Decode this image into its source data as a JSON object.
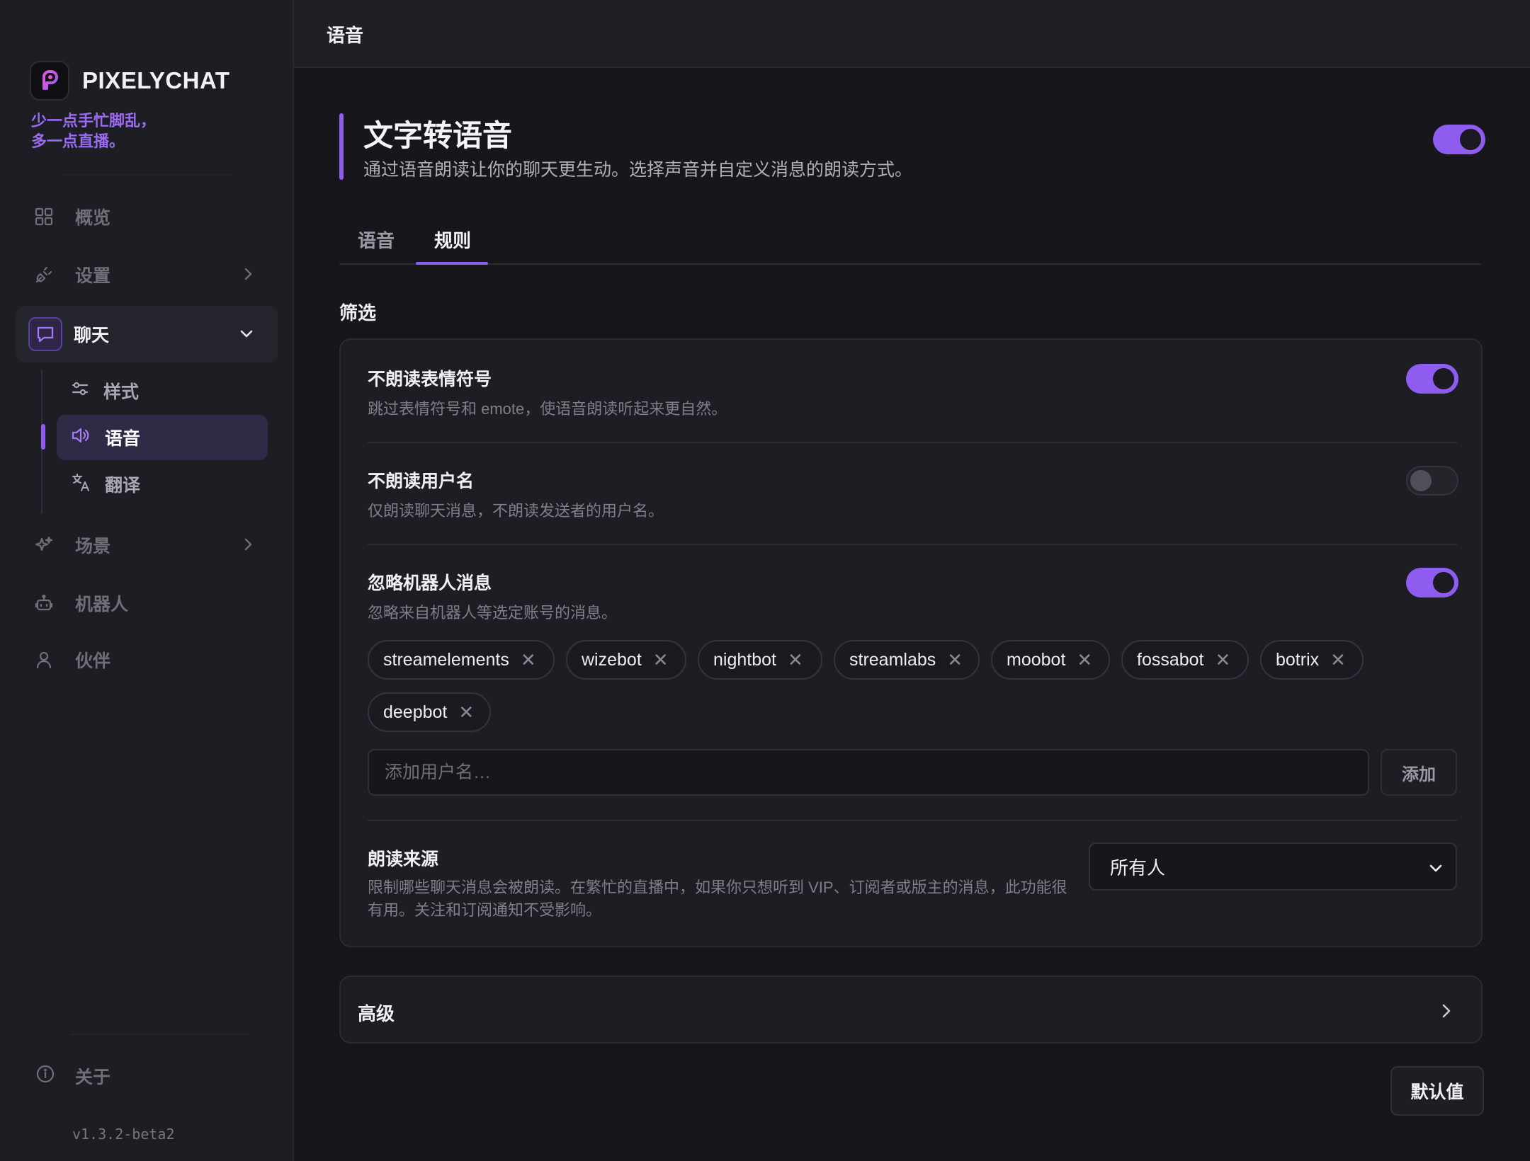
{
  "app": {
    "name": "PIXELYCHAT",
    "tagline": [
      "少一点手忙脚乱，",
      "多一点直播。"
    ],
    "version": "v1.3.2-beta2",
    "accent_color": "#8f5cf0"
  },
  "sidebar": {
    "items": [
      {
        "label": "概览",
        "icon": "grid-icon"
      },
      {
        "label": "设置",
        "icon": "plug-icon"
      },
      {
        "label": "聊天",
        "icon": "chat-bubble-icon",
        "expanded": true
      },
      {
        "label": "场景",
        "icon": "sparkle-icon"
      },
      {
        "label": "机器人",
        "icon": "robot-icon"
      },
      {
        "label": "伙伴",
        "icon": "user-icon"
      }
    ],
    "chat_subitems": [
      {
        "label": "样式",
        "icon": "sliders-icon"
      },
      {
        "label": "语音",
        "icon": "speaker-icon",
        "active": true
      },
      {
        "label": "翻译",
        "icon": "translate-icon"
      }
    ],
    "about": {
      "label": "关于",
      "icon": "info-icon"
    }
  },
  "topbar": {
    "title": "语音"
  },
  "header": {
    "title": "文字转语音",
    "description": "通过语音朗读让你的聊天更生动。选择声音并自定义消息的朗读方式。",
    "enabled": true
  },
  "tabs": [
    {
      "label": "语音",
      "active": false
    },
    {
      "label": "规则",
      "active": true
    }
  ],
  "filter": {
    "section_title": "筛选",
    "rows": [
      {
        "title": "不朗读表情符号",
        "description": "跳过表情符号和 emote，使语音朗读听起来更自然。",
        "enabled": true
      },
      {
        "title": "不朗读用户名",
        "description": "仅朗读聊天消息，不朗读发送者的用户名。",
        "enabled": false
      },
      {
        "title": "忽略机器人消息",
        "description": "忽略来自机器人等选定账号的消息。",
        "enabled": true
      }
    ],
    "ignored_users": [
      "streamelements",
      "wizebot",
      "nightbot",
      "streamlabs",
      "moobot",
      "fossabot",
      "botrix",
      "deepbot"
    ],
    "add_input_placeholder": "添加用户名…",
    "add_input_value": "",
    "add_button": "添加",
    "source": {
      "title": "朗读来源",
      "description": "限制哪些聊天消息会被朗读。在繁忙的直播中，如果你只想听到 VIP、订阅者或版主的消息，此功能很有用。关注和订阅通知不受影响。",
      "selected": "所有人"
    }
  },
  "advanced": {
    "label": "高级"
  },
  "default_button": "默认值"
}
